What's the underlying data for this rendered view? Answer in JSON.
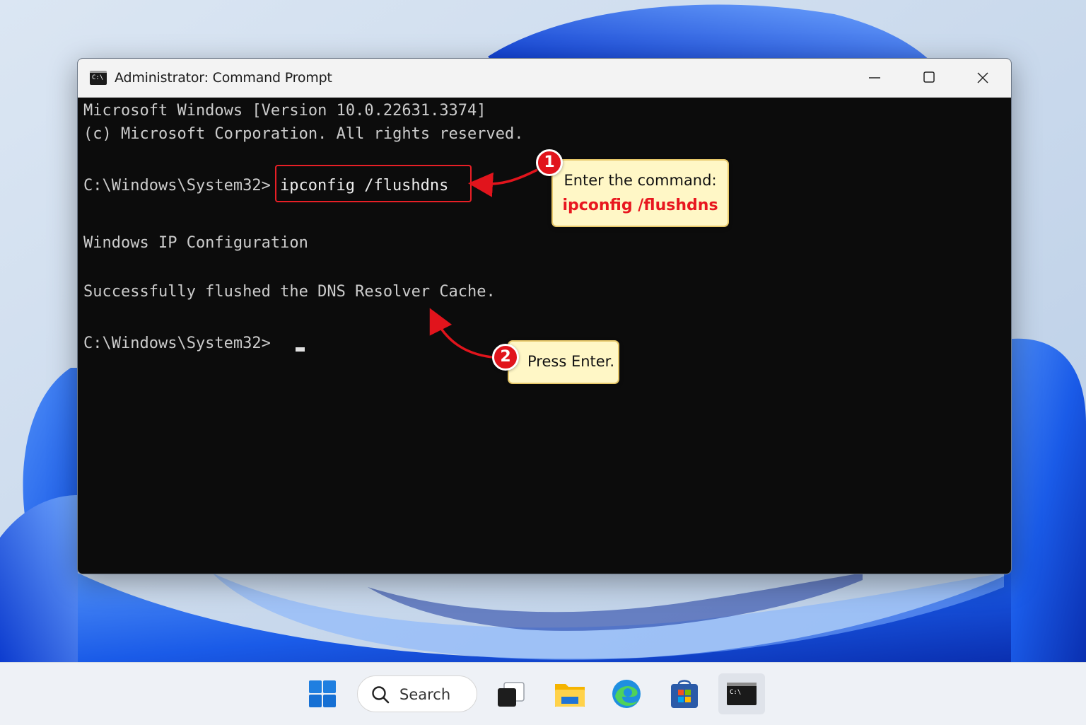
{
  "window": {
    "title": "Administrator: Command Prompt"
  },
  "console": {
    "lines": [
      "Microsoft Windows [Version 10.0.22631.3374]",
      "(c) Microsoft Corporation. All rights reserved.",
      "C:\\Windows\\System32>",
      "ipconfig /flushdns",
      "Windows IP Configuration",
      "Successfully flushed the DNS Resolver Cache.",
      "C:\\Windows\\System32>"
    ]
  },
  "callouts": [
    {
      "badge": "1",
      "title": "Enter the command:",
      "command": "ipconfig /flushdns"
    },
    {
      "badge": "2",
      "text": "Press Enter."
    }
  ],
  "taskbar": {
    "search_label": "Search",
    "icons": [
      "windows-start-icon",
      "search-icon",
      "task-view-icon",
      "file-explorer-icon",
      "edge-icon",
      "store-icon",
      "command-prompt-icon"
    ]
  },
  "colors": {
    "accent_red": "#e81f26",
    "callout_bg": "#fff7c6",
    "console_bg": "#0c0c0c",
    "console_text": "#cccccc"
  }
}
